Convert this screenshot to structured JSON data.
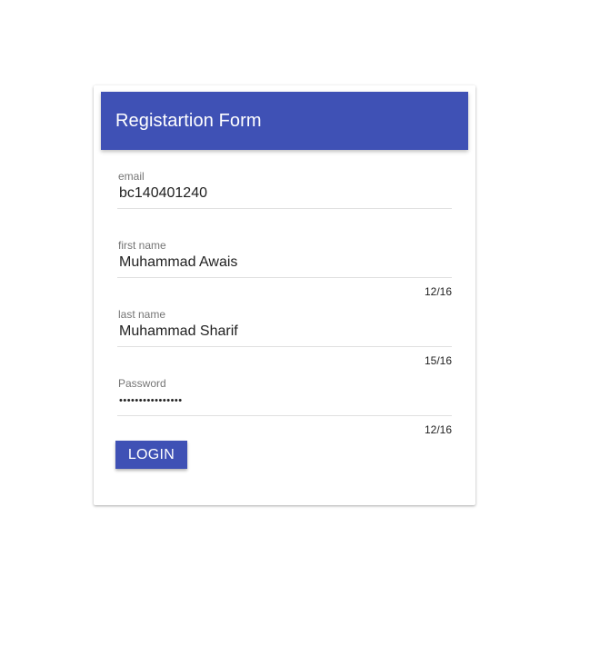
{
  "form": {
    "title": "Registartion Form",
    "fields": [
      {
        "label": "email",
        "value": "bc140401240",
        "counter": ""
      },
      {
        "label": "first name",
        "value": "Muhammad Awais",
        "counter": "12/16"
      },
      {
        "label": "last name",
        "value": "Muhammad Sharif",
        "counter": "15/16"
      },
      {
        "label": "Password",
        "value": "••••••••••••••••",
        "counter": "12/16"
      }
    ],
    "login_label": "LOGIN"
  },
  "colors": {
    "primary": "#3f51b5",
    "header_text": "#ffffff",
    "label": "#757575",
    "divider": "#e0e0e0"
  }
}
